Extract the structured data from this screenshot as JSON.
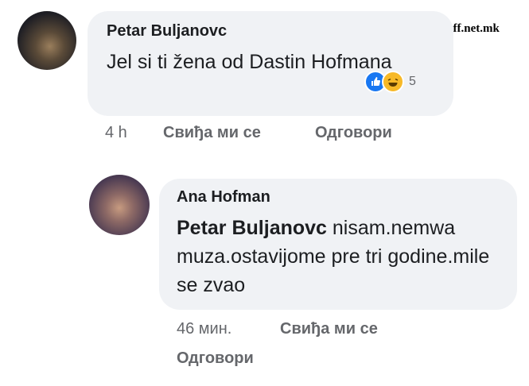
{
  "watermark": "off.net.mk",
  "comment": {
    "author": "Petar Buljanovc",
    "text": "Jel si ti žena od Dastin Hofmana",
    "reaction_count": "5",
    "reactions": [
      "like-icon",
      "haha-icon"
    ],
    "time": "4 h",
    "like_label": "Свиђа ми се",
    "reply_label": "Одговори"
  },
  "reply": {
    "author": "Ana Hofman",
    "mention": "Petar Buljanovc",
    "text": "nisam.nemwa muza.ostavijome pre tri godine.mile se zvao",
    "time": "46 мин.",
    "like_label": "Свиђа ми се",
    "reply_label": "Одговори"
  }
}
